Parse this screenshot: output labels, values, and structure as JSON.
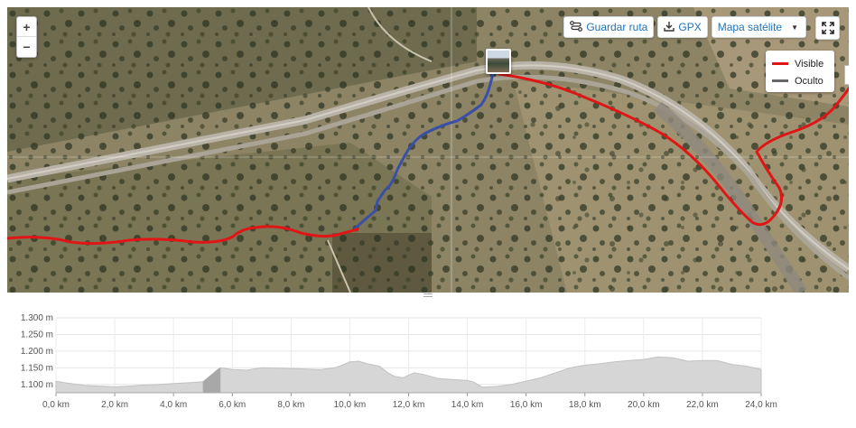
{
  "map": {
    "zoom": {
      "in_label": "+",
      "out_label": "−"
    },
    "toolbar": {
      "save_route_label": "Guardar ruta",
      "gpx_label": "GPX",
      "map_type_label": "Mapa satélite"
    },
    "legend": [
      {
        "label": "Visible",
        "color": "#e01515"
      },
      {
        "label": "Oculto",
        "color": "#666666"
      }
    ],
    "colors": {
      "visible_track": "#e01515",
      "hidden_track": "#3a4fa8"
    },
    "icons": [
      "plus-icon",
      "minus-icon",
      "route-icon",
      "download-icon",
      "caret-down-icon",
      "fullscreen-icon",
      "photo-marker"
    ]
  },
  "chart_data": {
    "type": "area",
    "title": "",
    "xlabel": "",
    "ylabel": "",
    "x_unit": "km",
    "y_unit": "m",
    "xlim": [
      0,
      24
    ],
    "ylim": [
      1075,
      1300
    ],
    "xticks": [
      "0,0 km",
      "2,0 km",
      "4,0 km",
      "6,0 km",
      "8,0 km",
      "10,0 km",
      "12,0 km",
      "14,0 km",
      "16,0 km",
      "18,0 km",
      "20,0 km",
      "22,0 km",
      "24,0 km"
    ],
    "yticks": [
      "1.300 m",
      "1.250 m",
      "1.200 m",
      "1.150 m",
      "1.100 m"
    ],
    "grid": true,
    "highlight_range_km": [
      5.0,
      5.6
    ],
    "series": [
      {
        "x": [
          0,
          0.3,
          1,
          1.5,
          2,
          2.5,
          3,
          3.5,
          4,
          4.5,
          5,
          5.3,
          5.5,
          5.6,
          6,
          6.5,
          7,
          8,
          9,
          9.5,
          9.8,
          10,
          10.3,
          10.6,
          11,
          11.3,
          11.5,
          11.8,
          12,
          12.2,
          12.5,
          13,
          13.5,
          14,
          14.2,
          14.5,
          15,
          15.5,
          16,
          16.5,
          17,
          17.5,
          18,
          18.5,
          19,
          19.5,
          20,
          20.5,
          21,
          21.5,
          22,
          22.5,
          23,
          23.5,
          24
        ],
        "y": [
          1110,
          1105,
          1097,
          1095,
          1093,
          1095,
          1098,
          1100,
          1103,
          1105,
          1108,
          1130,
          1145,
          1150,
          1145,
          1143,
          1150,
          1148,
          1145,
          1150,
          1160,
          1168,
          1170,
          1162,
          1155,
          1135,
          1125,
          1120,
          1128,
          1135,
          1130,
          1118,
          1115,
          1112,
          1108,
          1092,
          1094,
          1100,
          1110,
          1120,
          1135,
          1150,
          1158,
          1162,
          1168,
          1172,
          1175,
          1183,
          1180,
          1170,
          1172,
          1172,
          1160,
          1155,
          1145
        ]
      }
    ]
  }
}
